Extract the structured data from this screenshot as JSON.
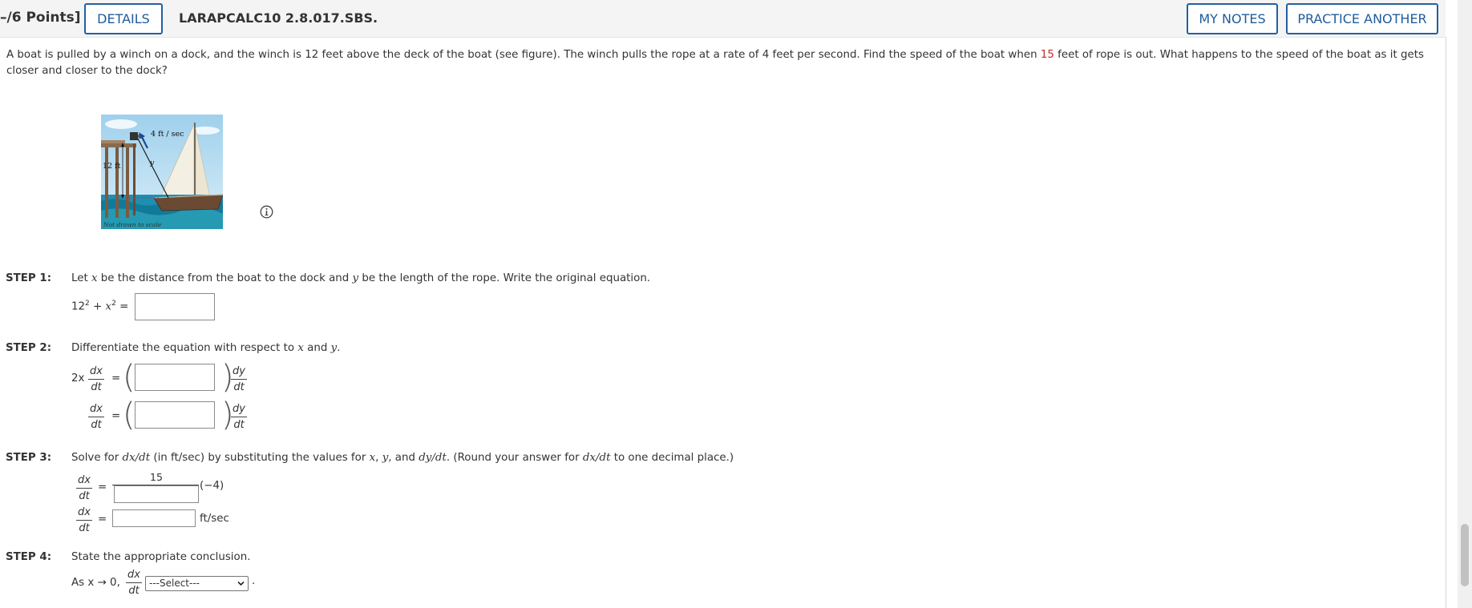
{
  "header": {
    "points": "–/6 Points]",
    "details_label": "DETAILS",
    "problem_id": "LARAPCALC10 2.8.017.SBS.",
    "my_notes_label": "MY NOTES",
    "practice_label": "PRACTICE ANOTHER"
  },
  "problem": {
    "text_1": "A boat is pulled by a winch on a dock, and the winch is 12 feet above the deck of the boat (see figure). The winch pulls the rope at a rate of 4 feet per second. Find the speed of the boat when ",
    "highlight": "15",
    "text_2": " feet of rope is out. What happens to the speed of the boat as it gets closer and closer to the dock?"
  },
  "figure": {
    "rate_label": "4 ft / sec",
    "height_label": "12 ft",
    "rope_label": "y",
    "caption": "Not drawn to scale"
  },
  "step1": {
    "label": "STEP 1:",
    "instr_a": "Let ",
    "var_x": "x",
    "instr_b": " be the distance from the boat to the dock and ",
    "var_y": "y",
    "instr_c": " be the length of the rope. Write the original equation.",
    "eq_base": "12",
    "eq_exp": "2",
    "eq_plus": " + ",
    "eq_x": "x",
    "eq_exp2": "2",
    "eq_equals": " ="
  },
  "step2": {
    "label": "STEP 2:",
    "instr_a": "Differentiate the equation with respect to ",
    "var_x": "x",
    "instr_b": " and ",
    "var_y": "y",
    "instr_c": ".",
    "coef": "2x",
    "equals": "=",
    "dx": "dx",
    "dy": "dy",
    "dt": "dt"
  },
  "step3": {
    "label": "STEP 3:",
    "instr_a": "Solve for ",
    "dxdt": "dx/dt",
    "instr_b": " (in ft/sec) by substituting the values for ",
    "x": "x",
    "instr_c": ", ",
    "y": "y",
    "instr_d": ", and ",
    "dydt": "dy/dt",
    "instr_e": ". (Round your answer for ",
    "dxdt2": "dx/dt",
    "instr_f": " to one decimal place.)",
    "numerator": "15",
    "factor": "(−4)",
    "unit": "ft/sec",
    "equals": "="
  },
  "step4": {
    "label": "STEP 4:",
    "instr": "State the appropriate conclusion.",
    "as_text": "As x → 0,",
    "select_value": "---Select---",
    "period": "."
  }
}
